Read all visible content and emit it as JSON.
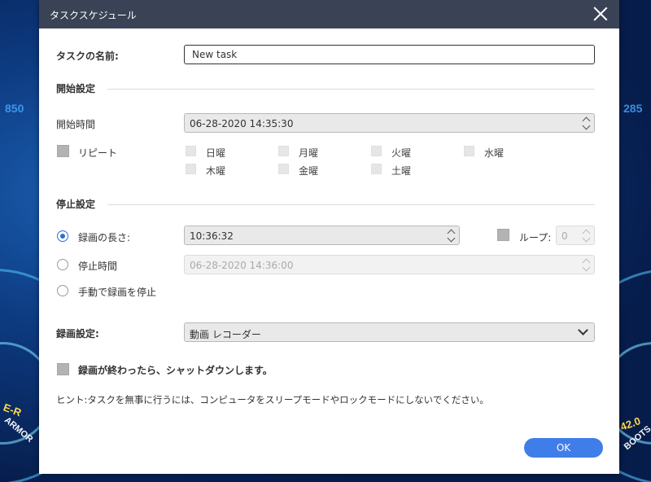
{
  "background": {
    "numbers": [
      "850",
      "285"
    ],
    "left_badge": "ARMOR",
    "left_badge_top": "E-R",
    "right_badge": "BOOTS",
    "right_badge_top": "42.0"
  },
  "dialog": {
    "title": "タスクスケジュール",
    "task_name_label": "タスクの名前:",
    "task_name_value": "New task",
    "start_section_title": "開始設定",
    "start_time_label": "開始時間",
    "start_time_value": "06-28-2020 14:35:30",
    "repeat_label": "リピート",
    "days": [
      "日曜",
      "月曜",
      "火曜",
      "水曜",
      "木曜",
      "金曜",
      "土曜"
    ],
    "stop_section_title": "停止設定",
    "stop_options": [
      {
        "label": "録画の長さ:",
        "selected": true
      },
      {
        "label": "停止時間",
        "selected": false
      },
      {
        "label": "手動で録画を停止",
        "selected": false
      }
    ],
    "duration_value": "10:36:32",
    "loop_label": "ループ:",
    "loop_value": "0",
    "stop_time_value": "06-28-2020 14:36:00",
    "recording_settings_label": "録画設定:",
    "recording_settings_value": "動画 レコーダー",
    "shutdown_label": "録画が終わったら、シャットダウンします。",
    "hint": "ヒント:タスクを無事に行うには、コンピュータをスリープモードやロックモードにしないでください。",
    "ok_label": "OK"
  },
  "colors": {
    "titlebar": "#3a4356",
    "accent": "#3f7ee8",
    "radio_selected": "#2e6bd6"
  }
}
